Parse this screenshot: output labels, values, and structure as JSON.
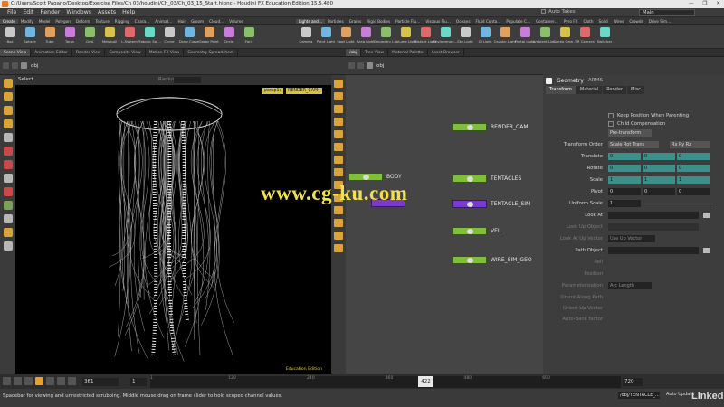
{
  "window": {
    "title": "C:/Users/Scott Pagano/Desktop/Exercise Files/Ch 03/houdini/Ch_03/Ch_03_15_Start.hipnc - Houdini FX Education Edition 15.5.480",
    "minimize": "—",
    "maximize": "❐",
    "close": "✕"
  },
  "menu": {
    "items": [
      "File",
      "Edit",
      "Render",
      "Windows",
      "Assets",
      "Help"
    ],
    "auto_takes": "Auto Takes",
    "desktop": "Main"
  },
  "shelf_left": {
    "tabs": [
      "Create",
      "Modify",
      "Model",
      "Polygon",
      "Deform",
      "Texture",
      "Rigging",
      "Chara…",
      "Animat…",
      "Hair",
      "Groom",
      "Cloud…",
      "Volume"
    ],
    "tools": [
      "Box",
      "Sphere",
      "Tube",
      "Torus",
      "Grid",
      "Metaball",
      "L-System",
      "Platonic Sol…",
      "Curve",
      "Draw Curve",
      "Spray Paint",
      "Circle",
      "Font"
    ]
  },
  "shelf_right": {
    "tabs": [
      "Lights and…",
      "Particles",
      "Grains",
      "Rigid Bodies",
      "Particle Flu…",
      "Viscous Flu…",
      "Oceans",
      "Fluid Conta…",
      "Populate C…",
      "Container…",
      "Pyro FX",
      "Cloth",
      "Solid",
      "Wires",
      "Crowds",
      "Drive Sim…"
    ],
    "tools": [
      "Camera",
      "Point Light",
      "Spot Light",
      "Area Light",
      "Geometry L…",
      "Volume Light",
      "Distant Light",
      "Environmen…",
      "Sky Light",
      "GI Light",
      "Caustic Light",
      "Portal Light",
      "Ambient Lig…",
      "Stereo Cam…",
      "VR Camera",
      "Switcher"
    ]
  },
  "left_pane_tabs": [
    "Scene View",
    "Animation Editor",
    "Render View",
    "Composite View",
    "Motion FX View",
    "Geometry Spreadsheet"
  ],
  "right_pane_tabs": [
    "/obj",
    "Tree View",
    "Material Palette",
    "Asset Browser"
  ],
  "left_path": "obj",
  "right_path": "obj",
  "viewport": {
    "tool_name": "Select",
    "radius_label": "Radius",
    "perspective": "persp1▾",
    "camera": "RENDER_CAM▾",
    "edition_label": "Education Edition"
  },
  "network": {
    "nodes": [
      {
        "name": "RENDER_CAM",
        "kind": "camera"
      },
      {
        "name": "BODY",
        "kind": "geo"
      },
      {
        "name": "TENTACLES",
        "kind": "geo"
      },
      {
        "name": "TENTACLE_SIM",
        "kind": "dop"
      },
      {
        "name": "VEL",
        "kind": "geo"
      },
      {
        "name": "WIRE_SIM_GEO",
        "kind": "geo"
      }
    ]
  },
  "params": {
    "type": "Geometry",
    "node_name": "ARMS",
    "tabs": [
      "Transform",
      "Material",
      "Render",
      "Misc"
    ],
    "keep_position": "Keep Position When Parenting",
    "child_comp": "Child Compensation",
    "pre_transform": "Pre-transform",
    "transform_order_label": "Transform Order",
    "transform_order": "Scale Rot Trans",
    "rot_order": "Rx Ry Rz",
    "translate_label": "Translate",
    "translate": [
      "0",
      "0",
      "0"
    ],
    "rotate_label": "Rotate",
    "rotate": [
      "0",
      "0",
      "0"
    ],
    "scale_label": "Scale",
    "scale": [
      "1",
      "1",
      "1"
    ],
    "pivot_label": "Pivot",
    "pivot": [
      "0",
      "0",
      "0"
    ],
    "uniform_scale_label": "Uniform Scale",
    "uniform_scale": "1",
    "look_at_label": "Look At",
    "look_up_object_label": "Look Up Object",
    "look_at_up_vector_label": "Look At Up Vector",
    "look_at_up_vector": "Use Up Vector",
    "path_object_label": "Path Object",
    "roll_label": "Roll",
    "position_label": "Position",
    "param_label": "Parameterization",
    "param_value": "Arc Length",
    "orient_label": "Orient Along Path",
    "orient_up_label": "Orient Up Vector",
    "auto_bank_label": "Auto-Bank factor"
  },
  "timeline": {
    "current_frame": "361",
    "start_frame": "1",
    "end_frame": "720",
    "playhead_frame": "422",
    "ticks": [
      "1",
      "120",
      "240",
      "360",
      "480",
      "600"
    ],
    "range_start": 1,
    "range_end": 720,
    "playhead_value": 422
  },
  "status": {
    "message": "Spacebar for viewing and unrestricted scrubbing. Middle mouse drag on frame slider to hold scoped channel values.",
    "scope_path": "/obj/TENTACLE_…",
    "auto_update": "Auto Update"
  },
  "overlays": {
    "url": "www.cg-ku.com",
    "brand": "Linkedin"
  },
  "colors": {
    "node_geo": "#7fbf3a",
    "node_dop": "#7a3ad0",
    "tool_accent": "#d9a43a",
    "param_field": "#3d8f8a",
    "overlay_text": "#f2e24a"
  }
}
